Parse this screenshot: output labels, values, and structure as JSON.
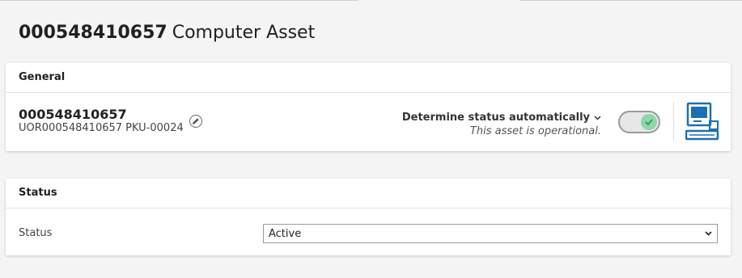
{
  "page": {
    "asset_id": "000548410657",
    "asset_type": "Computer Asset"
  },
  "general": {
    "section_title": "General",
    "asset_id": "000548410657",
    "asset_sub": "UOR000548410657 PKU-00024",
    "status_auto_label": "Determine status automatically",
    "status_note": "This asset is operational.",
    "toggle_state": "on",
    "icons": {
      "edit": "pencil-icon",
      "toggle": "check-icon",
      "device": "computer-icon",
      "dropdown": "chevron-down-icon"
    },
    "colors": {
      "accent": "#1e6fb0",
      "toggle_knob": "#8fd6a8",
      "toggle_check": "#2e8b57"
    }
  },
  "status": {
    "section_title": "Status",
    "field_label": "Status",
    "value": "Active"
  }
}
